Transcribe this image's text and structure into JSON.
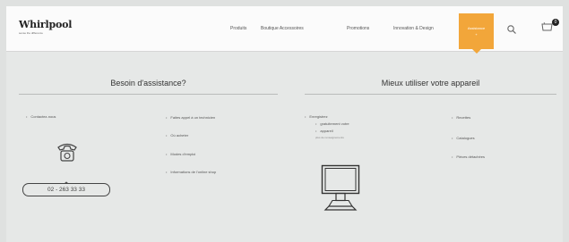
{
  "header": {
    "logo": "Whirlpool",
    "logo_tagline": "sense the difference",
    "nav": [
      "Produits",
      "Boutique Accessoires",
      "Promotions",
      "Innovation & Design"
    ],
    "active_tab": {
      "line1": "Assistance",
      "line2": "+"
    },
    "search_icon": "search-icon",
    "cart_icon": "cart-icon",
    "cart_badge": "0",
    "accent_color": "#f2a63a"
  },
  "left": {
    "title": "Besoin d'assistance?",
    "contact_link": "Contactez-nous",
    "links": [
      "Faites appel à un technicien",
      "Où acheter",
      "Modes d'emploi",
      "Informations de l'online shop"
    ],
    "phone": "02 - 263 33 33"
  },
  "right": {
    "title": "Mieux utiliser votre appareil",
    "register": {
      "line1": "Enregistrez",
      "line2": "gratuitement votre",
      "line3": "appareil",
      "sub": "plus de renseignements"
    },
    "col2": [
      "Recettes",
      "Catalogues",
      "Pièces détachées"
    ]
  }
}
